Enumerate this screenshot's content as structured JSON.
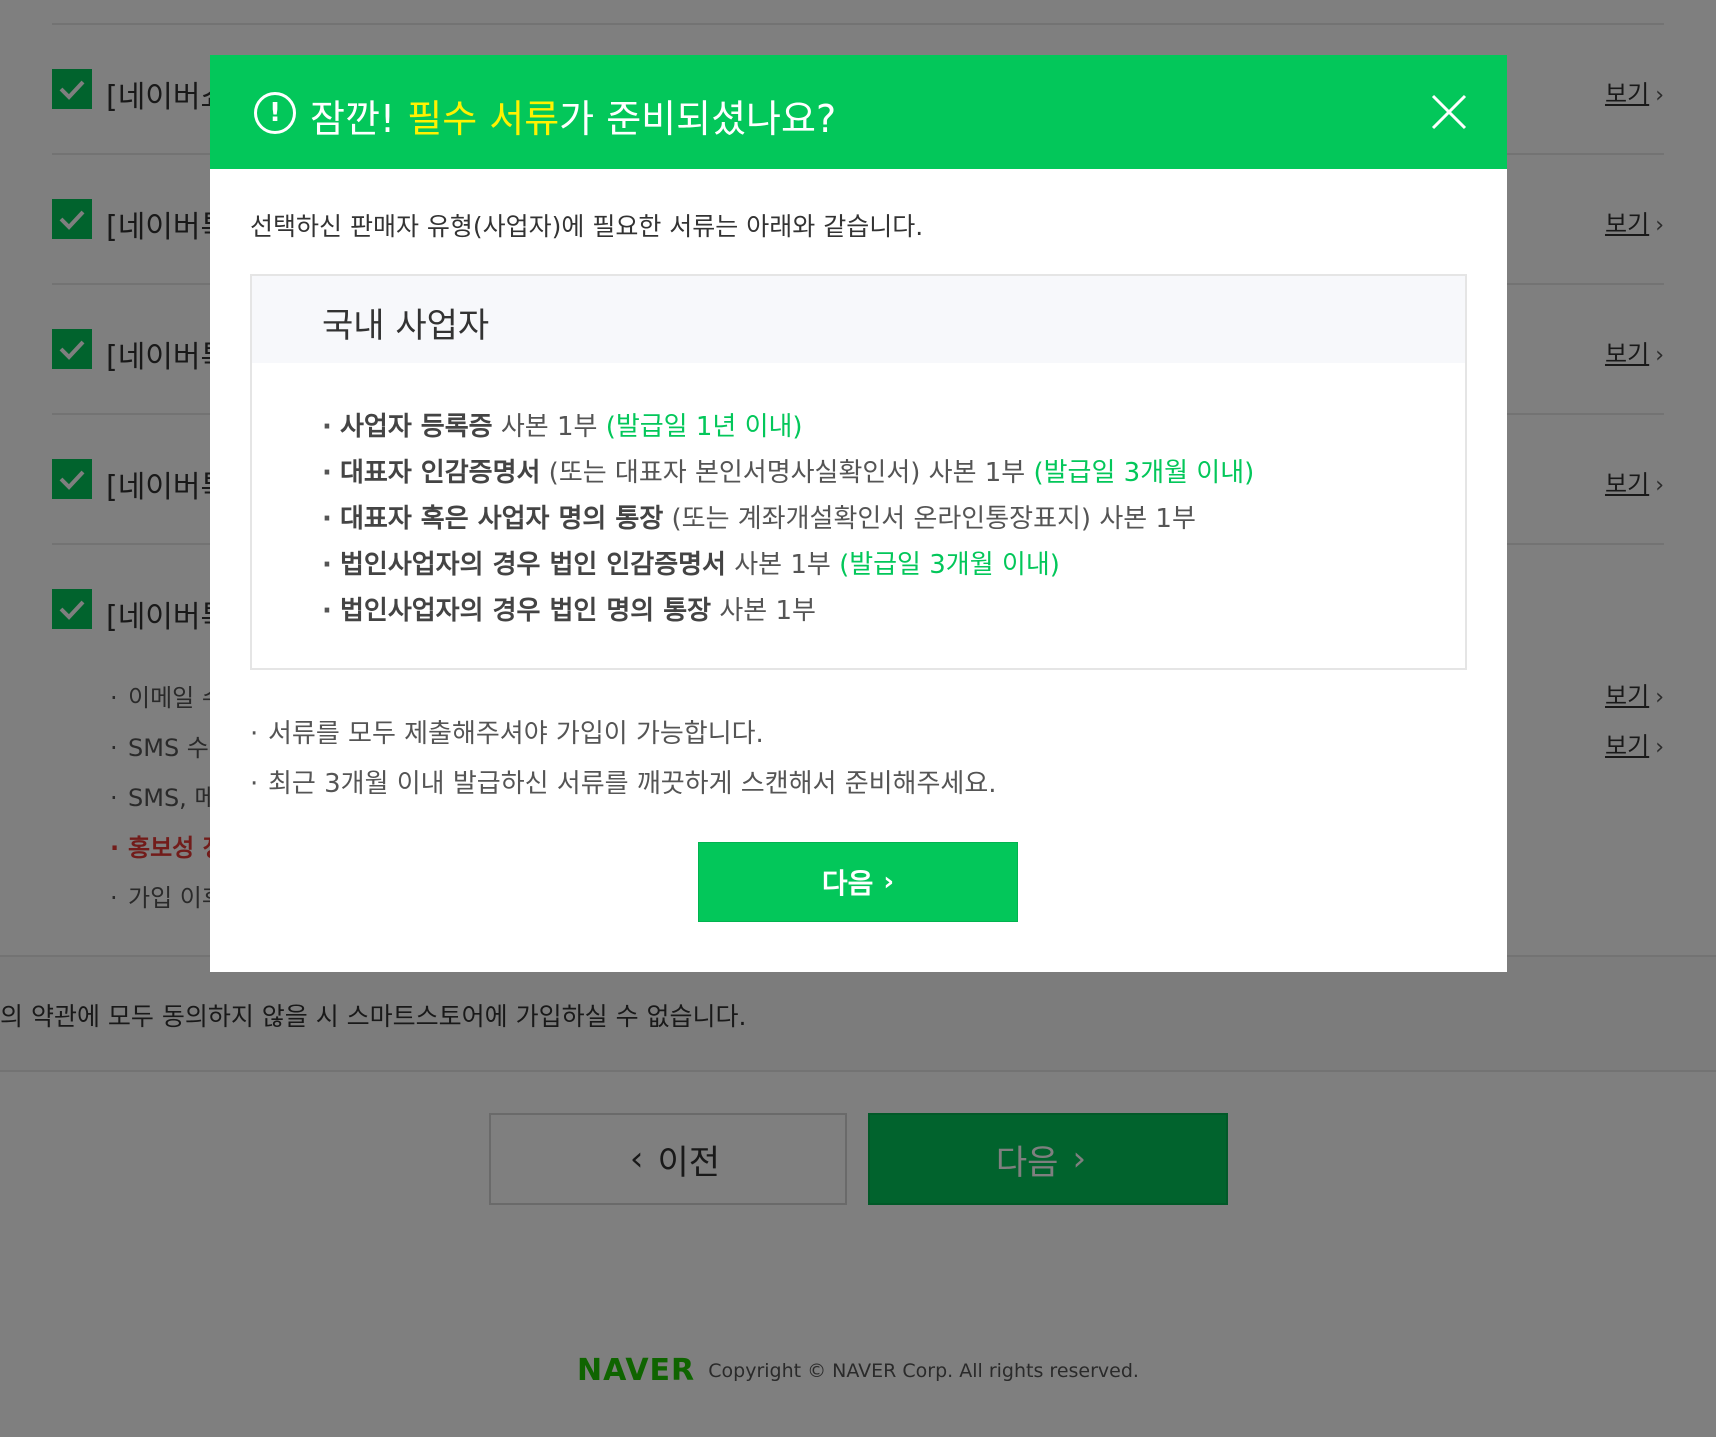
{
  "background": {
    "terms": [
      {
        "title": "[네이버쇼",
        "view": "보기"
      },
      {
        "title": "[네이버톡",
        "view": "보기"
      },
      {
        "title": "[네이버톡",
        "view": "보기"
      },
      {
        "title": "[네이버톡",
        "view": "보기"
      },
      {
        "title": "[네이버톡",
        "view": ""
      }
    ],
    "sub_items": [
      {
        "text": "이메일 수",
        "view": "보기"
      },
      {
        "text": "SMS 수",
        "view": "보기"
      },
      {
        "text": "SMS, 메",
        "view": ""
      },
      {
        "text": "홍보성 정",
        "view": ""
      },
      {
        "text": "가입 이후",
        "view": ""
      }
    ],
    "notice": "의 약관에 모두 동의하지 않을 시 스마트스토어에 가입하실 수 없습니다.",
    "prev_label": "이전",
    "next_label": "다음",
    "footer": {
      "logo": "NAVER",
      "copyright": "Copyright © NAVER Corp. All rights reserved."
    }
  },
  "modal": {
    "title_prefix": "잠깐! ",
    "title_highlight": "필수 서류",
    "title_suffix": "가 준비되셨나요?",
    "intro": "선택하신 판매자 유형(사업자)에 필요한 서류는 아래와 같습니다.",
    "box_title": "국내 사업자",
    "documents": [
      {
        "bold": "사업자 등록증",
        "normal": " 사본 1부 ",
        "green": "(발급일 1년 이내)"
      },
      {
        "bold": "대표자 인감증명서",
        "normal": " (또는 대표자 본인서명사실확인서) 사본 1부 ",
        "green": "(발급일 3개월 이내)"
      },
      {
        "bold": "대표자 혹은 사업자 명의 통장",
        "normal": " (또는 계좌개설확인서 온라인통장표지) 사본 1부",
        "green": ""
      },
      {
        "bold": "법인사업자의 경우 법인 인감증명서",
        "normal": " 사본 1부 ",
        "green": "(발급일 3개월 이내)"
      },
      {
        "bold": "법인사업자의 경우 법인 명의 통장",
        "normal": " 사본 1부",
        "green": ""
      }
    ],
    "notes": [
      "서류를 모두 제출해주셔야 가입이 가능합니다.",
      "최근 3개월 이내 발급하신 서류를 깨끗하게 스캔해서 준비해주세요."
    ],
    "next_label": "다음",
    "alert_glyph": "!"
  },
  "colors": {
    "accent": "#03c75a",
    "highlight": "#fff200",
    "warning": "#e53935"
  },
  "icons": [
    "alert-circle-icon",
    "close-icon",
    "checkmark-icon",
    "chevron-right-icon",
    "chevron-left-icon"
  ]
}
